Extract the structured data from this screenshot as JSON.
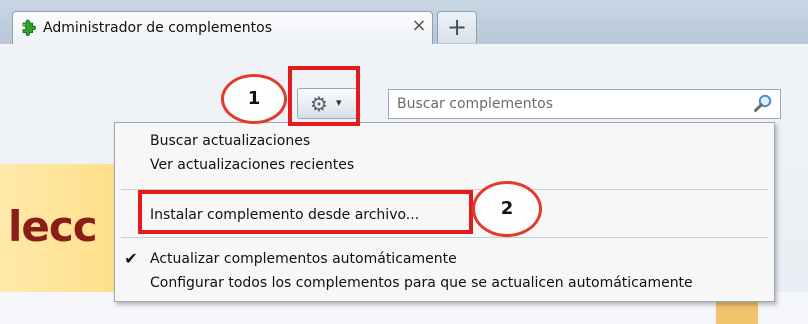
{
  "tab": {
    "title": "Administrador de complementos",
    "close_icon": "close-icon",
    "new_tab_label": "+",
    "icon": "puzzle-icon"
  },
  "toolbar": {
    "gear_icon": "gear-icon",
    "dropdown_icon": "chevron-down-icon",
    "search_placeholder": "Buscar complementos",
    "search_icon": "search-icon"
  },
  "page": {
    "heading_partial": "lecc"
  },
  "menu": {
    "items": [
      {
        "label": "Buscar actualizaciones"
      },
      {
        "label": "Ver actualizaciones recientes"
      },
      {
        "label": "Instalar complemento desde archivo..."
      },
      {
        "label": "Actualizar complementos automáticamente",
        "checked": true
      },
      {
        "label": "Configurar todos los complementos para que se actualicen automáticamente"
      }
    ],
    "check_symbol": "✔"
  },
  "annotations": {
    "callout_1": "1",
    "callout_2": "2",
    "highlight_color": "#e31b1b"
  },
  "colors": {
    "heading": "#8b1d15",
    "left_panel": "#ffe08c",
    "annotation": "#e31b1b"
  }
}
